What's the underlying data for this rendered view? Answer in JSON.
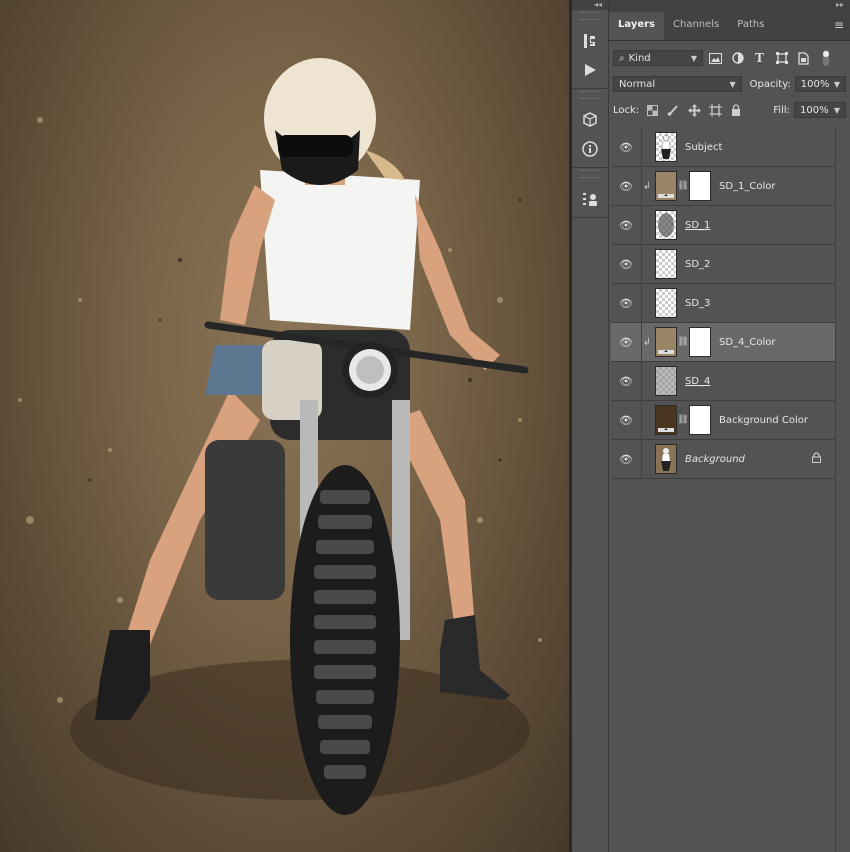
{
  "panel": {
    "tabs": [
      {
        "label": "Layers"
      },
      {
        "label": "Channels"
      },
      {
        "label": "Paths"
      }
    ],
    "filter": {
      "kind_label": "Kind"
    },
    "blend_mode": "Normal",
    "opacity": {
      "label": "Opacity:",
      "value": "100%"
    },
    "lock": {
      "label": "Lock:"
    },
    "fill": {
      "label": "Fill:",
      "value": "100%"
    },
    "layers": [
      {
        "name": "Subject"
      },
      {
        "name": "SD_1_Color"
      },
      {
        "name": "SD_1"
      },
      {
        "name": "SD_2"
      },
      {
        "name": "SD_3"
      },
      {
        "name": "SD_4_Color"
      },
      {
        "name": "SD_4"
      },
      {
        "name": "Background Color"
      },
      {
        "name": "Background"
      }
    ]
  },
  "colors": {
    "swatch_tan": "#9a8667",
    "swatch_dark_brown": "#4a3422",
    "selected_row": "#696969"
  }
}
